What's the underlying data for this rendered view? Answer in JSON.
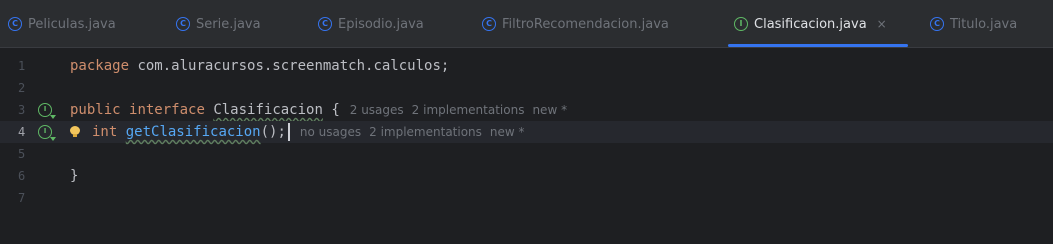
{
  "tabs": [
    {
      "icon": "C",
      "label": "Peliculas.java"
    },
    {
      "icon": "C",
      "label": "Serie.java"
    },
    {
      "icon": "C",
      "label": "Episodio.java"
    },
    {
      "icon": "C",
      "label": "FiltroRecomendacion.java"
    },
    {
      "icon": "I",
      "label": "Clasificacion.java",
      "close": "×",
      "active": true
    },
    {
      "icon": "C",
      "label": "Titulo.java"
    }
  ],
  "editor": {
    "line_numbers": [
      "1",
      "2",
      "3",
      "4",
      "5",
      "6",
      "7"
    ],
    "gutter_mark": "I",
    "line1": {
      "kw": "package",
      "rest": " com.aluracursos.screenmatch.calculos;"
    },
    "line3": {
      "kw1": "public",
      "kw2": "interface",
      "name": "Clasificacion",
      "brace": " {",
      "hints": [
        "2 usages",
        "2 implementations",
        "new *"
      ]
    },
    "line4": {
      "kw": "int",
      "method": "getClasificacion",
      "rest": "();",
      "hints": [
        "no usages",
        "2 implementations",
        "new *"
      ]
    },
    "line6": {
      "text": "}"
    }
  }
}
